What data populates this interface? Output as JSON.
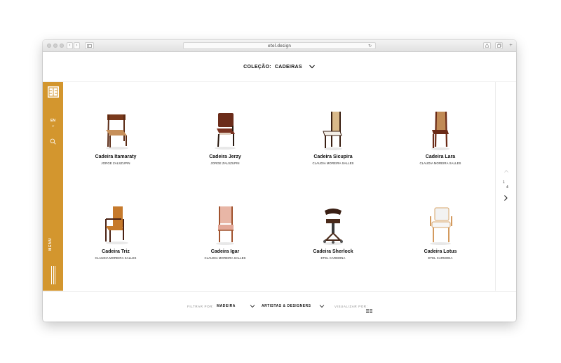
{
  "browser": {
    "url": "etel.design",
    "nav_back": "‹",
    "nav_forward": "›"
  },
  "header": {
    "label": "COLEÇÃO:",
    "value": "CADEIRAS"
  },
  "sidebar": {
    "lang_active": "EN",
    "lang_other": "IT",
    "menu_label": "MENU"
  },
  "products": [
    {
      "name": "Cadeira Itamaraty",
      "designer": "JORGE ZALSZUPIN",
      "style": "itamaraty"
    },
    {
      "name": "Cadeira Jerzy",
      "designer": "JORGE ZALSZUPIN",
      "style": "jerzy"
    },
    {
      "name": "Cadeira Sicupira",
      "designer": "CLAUDIA MOREIRA SALLES",
      "style": "sicupira"
    },
    {
      "name": "Cadeira Lara",
      "designer": "CLAUDIA MOREIRA SALLES",
      "style": "lara"
    },
    {
      "name": "Cadeira Triz",
      "designer": "CLAUDIA MOREIRA SALLES",
      "style": "triz"
    },
    {
      "name": "Cadeira Igar",
      "designer": "CLAUDIA MOREIRA SALLES",
      "style": "igar"
    },
    {
      "name": "Cadeira Sherlock",
      "designer": "ETEL CARMONA",
      "style": "sherlock"
    },
    {
      "name": "Cadeira Lotus",
      "designer": "ETEL CARMONA",
      "style": "lotus"
    }
  ],
  "pager": {
    "current": "1",
    "total": "4"
  },
  "footer": {
    "filter_label": "FILTRAR POR:",
    "filter_wood": "MADEIRA",
    "filter_artists": "ARTISTAS & DESIGNERS",
    "view_label": "VISUALIZAR POR:"
  },
  "colors": {
    "brand_accent": "#d3962e"
  }
}
